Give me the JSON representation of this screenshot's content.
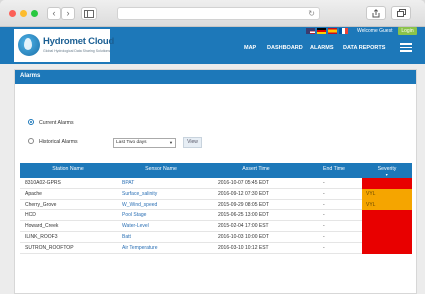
{
  "browser": {
    "back": "‹",
    "forward": "›",
    "reload": "↻"
  },
  "header": {
    "logo_name": "Hydromet Cloud",
    "logo_tagline": "Global Hydrological Data Sharing Solutions",
    "welcome": "Welcome Guest",
    "login": "Login",
    "nav": [
      "MAP",
      "DASHBOARD",
      "ALARMS",
      "DATA REPORTS"
    ]
  },
  "panel": {
    "title": "Alarms",
    "current_label": "Current Alarms",
    "historical_label": "Historical Alarms",
    "range_value": "Last Two days",
    "view_label": "View"
  },
  "table": {
    "columns": [
      "Station Name",
      "Sensor Name",
      "Assert Time",
      "End Time",
      "Severity"
    ],
    "rows": [
      {
        "station": "8310A02-GPRS",
        "sensor": "BPAT",
        "assert": "2016-10-07 05:45 EDT",
        "end": "-",
        "severity": "",
        "color": "#e80000"
      },
      {
        "station": "Apache",
        "sensor": "Surface_salinity",
        "assert": "2016-09-12 07:30 EDT",
        "end": "-",
        "severity": "VYL",
        "color": "#f5a500"
      },
      {
        "station": "Cherry_Grove",
        "sensor": "W_Wind_speed",
        "assert": "2015-09-29 08:05 EDT",
        "end": "-",
        "severity": "VYL",
        "color": "#f5a500"
      },
      {
        "station": "HCD",
        "sensor": "Pool Stage",
        "assert": "2015-06-25 13:00 EDT",
        "end": "-",
        "severity": "",
        "color": "#e80000"
      },
      {
        "station": "Howard_Creek",
        "sensor": "Water-Level",
        "assert": "2015-02-04 17:00 EST",
        "end": "-",
        "severity": "",
        "color": "#e80000"
      },
      {
        "station": "ILINK_ROOF3",
        "sensor": "Batt",
        "assert": "2016-10-03 10:00 EDT",
        "end": "-",
        "severity": "",
        "color": "#e80000"
      },
      {
        "station": "SUTRON_ROOFTOP",
        "sensor": "Air Temperature",
        "assert": "2016-03-10 10:12 EST",
        "end": "-",
        "severity": "",
        "color": "#e80000"
      }
    ]
  },
  "colors": {
    "brand_blue": "#1d78b9",
    "alarm_red": "#e80000",
    "alarm_orange": "#f5a500",
    "login_green": "#8bc34a"
  }
}
